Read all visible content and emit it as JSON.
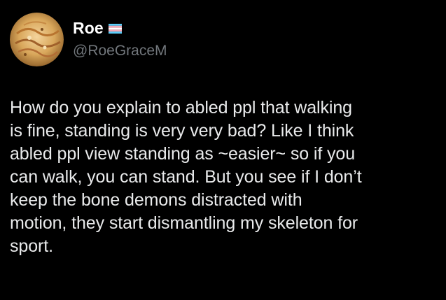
{
  "user": {
    "display_name": "Roe",
    "handle": "@RoeGraceM",
    "flag_icon": "transgender-flag-icon",
    "flag_colors": [
      "#5bcefa",
      "#f5a9b8",
      "#ffffff",
      "#f5a9b8",
      "#5bcefa"
    ]
  },
  "tweet": {
    "text": "How do you explain to abled ppl that walking\nis fine, standing is very very bad? Like I think\nabled ppl view standing as ~easier~ so if you\ncan walk, you can stand. But you see if I don’t\nkeep the bone demons distracted with\nmotion, they start dismantling my skeleton for\nsport."
  },
  "colors": {
    "background": "#000000",
    "text": "#e7e9ea",
    "handle": "#71767b"
  }
}
